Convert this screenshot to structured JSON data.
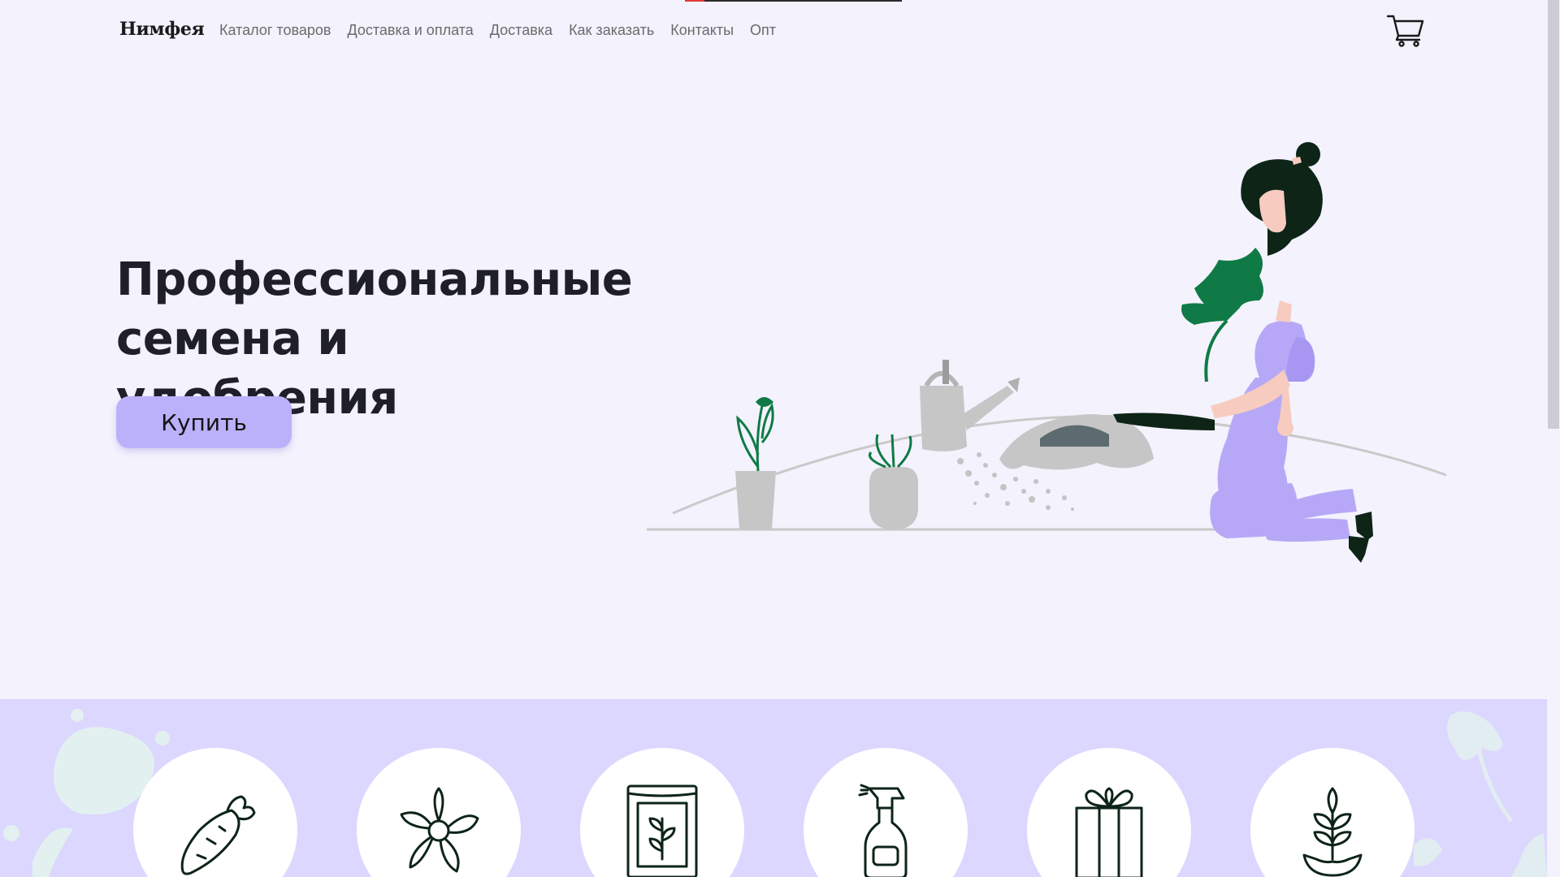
{
  "header": {
    "logo": "Нимфея",
    "nav": [
      {
        "label": "Каталог товаров"
      },
      {
        "label": "Доставка и оплата"
      },
      {
        "label": "Доставка"
      },
      {
        "label": "Как заказать"
      },
      {
        "label": "Контакты"
      },
      {
        "label": "Опт"
      }
    ],
    "cart_icon": "cart-icon"
  },
  "hero": {
    "title": "Профессиональные семена и удобрения",
    "buy_button": "Купить",
    "illustration": "woman-gardening-illustration"
  },
  "categories": [
    {
      "icon": "carrot-icon"
    },
    {
      "icon": "flower-icon"
    },
    {
      "icon": "seed-packet-icon"
    },
    {
      "icon": "spray-bottle-icon"
    },
    {
      "icon": "gift-box-icon"
    },
    {
      "icon": "seedling-pot-icon"
    }
  ],
  "colors": {
    "background": "#f3f2fd",
    "accent": "#bbb1fa",
    "band": "#dcd7fe",
    "leaf": "#0f7a45",
    "dark": "#0d2417",
    "skin": "#f7cbc0",
    "outfit": "#b7a8f7"
  }
}
